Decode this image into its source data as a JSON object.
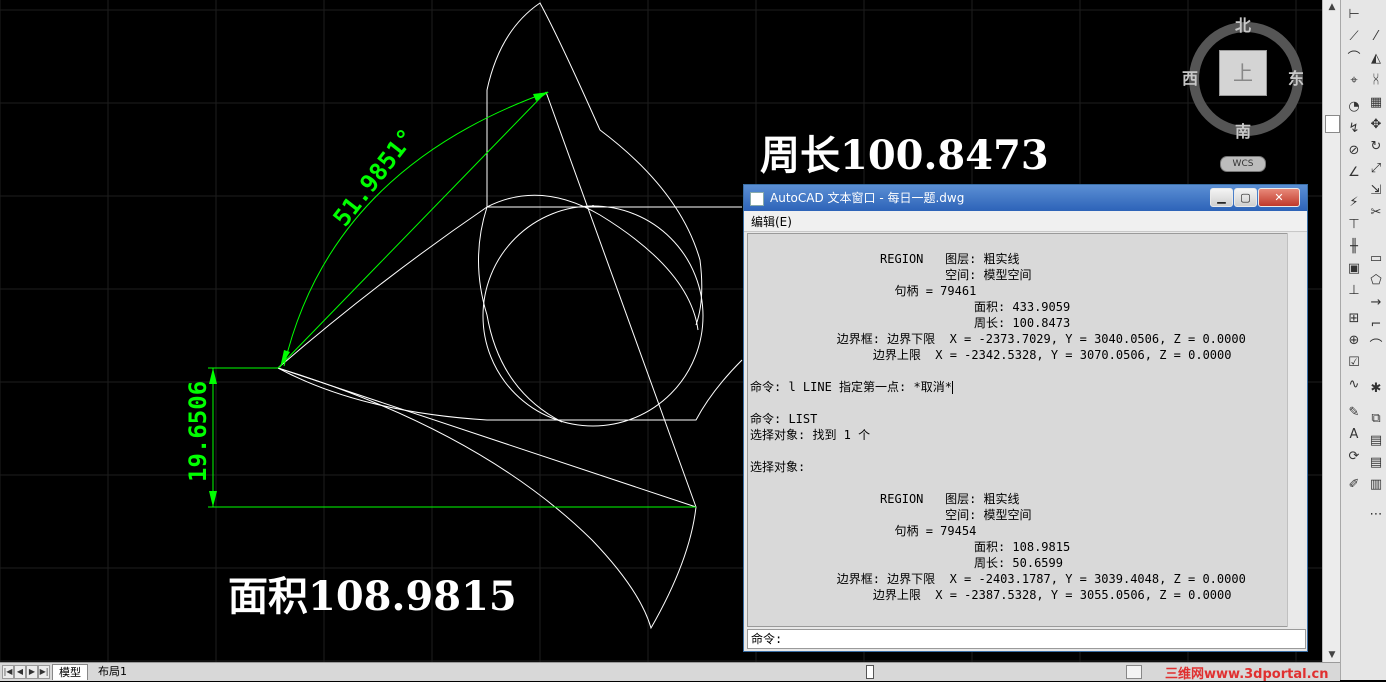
{
  "drawing": {
    "dimension_angle": "51.9851°",
    "dimension_height": "19.6506",
    "label_perimeter": "周长100.8473",
    "label_area": "面积108.9815",
    "linework_color": "#ffffff",
    "dimension_color": "#00ff00",
    "background_color": "#000000"
  },
  "viewcube": {
    "north": "北",
    "south": "南",
    "east": "东",
    "west": "西",
    "face": "上",
    "wcs": "WCS"
  },
  "text_window": {
    "title": "AutoCAD 文本窗口 - 每日一题.dwg",
    "menu_edit": "编辑(E)",
    "lines": [
      "                  REGION   图层: 粗实线",
      "                           空间: 模型空间",
      "                    句柄 = 79461",
      "                               面积: 433.9059",
      "                               周长: 100.8473",
      "            边界框: 边界下限  X = -2373.7029, Y = 3040.0506, Z = 0.0000",
      "                 边界上限  X = -2342.5328, Y = 3070.0506, Z = 0.0000",
      "",
      "命令: l LINE 指定第一点: *取消*",
      "",
      "命令: LIST",
      "选择对象: 找到 1 个",
      "",
      "选择对象:",
      "",
      "                  REGION   图层: 粗实线",
      "                           空间: 模型空间",
      "                    句柄 = 79454",
      "                               面积: 108.9815",
      "                               周长: 50.6599",
      "            边界框: 边界下限  X = -2403.1787, Y = 3039.4048, Z = 0.0000",
      "                 边界上限  X = -2387.5328, Y = 3055.0506, Z = 0.0000"
    ],
    "command_prompt": "命令:"
  },
  "layout_tabs": {
    "model": "模型",
    "layout1": "布局1"
  },
  "watermark": "三维网www.3dportal.cn"
}
